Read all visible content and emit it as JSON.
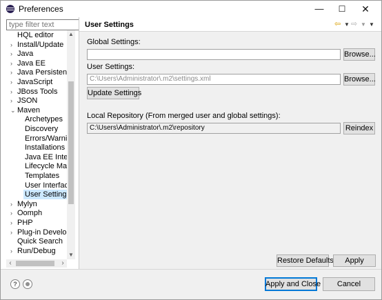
{
  "window": {
    "title": "Preferences"
  },
  "window_controls": {
    "minimize": "—",
    "maximize": "☐",
    "close": "✕"
  },
  "filter": {
    "placeholder": "type filter text"
  },
  "tree": {
    "items": [
      {
        "label": "HQL editor",
        "arrow": ""
      },
      {
        "label": "Install/Update",
        "arrow": "›"
      },
      {
        "label": "Java",
        "arrow": "›"
      },
      {
        "label": "Java EE",
        "arrow": "›"
      },
      {
        "label": "Java Persistence",
        "arrow": "›"
      },
      {
        "label": "JavaScript",
        "arrow": "›"
      },
      {
        "label": "JBoss Tools",
        "arrow": "›"
      },
      {
        "label": "JSON",
        "arrow": "›"
      },
      {
        "label": "Maven",
        "arrow": "⌄"
      },
      {
        "label": "Archetypes",
        "arrow": ""
      },
      {
        "label": "Discovery",
        "arrow": ""
      },
      {
        "label": "Errors/Warnings",
        "arrow": ""
      },
      {
        "label": "Installations",
        "arrow": ""
      },
      {
        "label": "Java EE Integration",
        "arrow": ""
      },
      {
        "label": "Lifecycle Mappings",
        "arrow": ""
      },
      {
        "label": "Templates",
        "arrow": ""
      },
      {
        "label": "User Interface",
        "arrow": ""
      },
      {
        "label": "User Settings",
        "arrow": ""
      },
      {
        "label": "Mylyn",
        "arrow": "›"
      },
      {
        "label": "Oomph",
        "arrow": "›"
      },
      {
        "label": "PHP",
        "arrow": "›"
      },
      {
        "label": "Plug-in Development",
        "arrow": "›"
      },
      {
        "label": "Quick Search",
        "arrow": ""
      },
      {
        "label": "Run/Debug",
        "arrow": "›"
      }
    ],
    "selected": "User Settings"
  },
  "scroll": {
    "up": "▲",
    "down": "▼",
    "left": "‹",
    "right": "›"
  },
  "page": {
    "title": "User Settings",
    "nav": {
      "back": "⇦",
      "back_dropdown": "▼",
      "forward": "⇨",
      "forward_dropdown": "▼",
      "menu": "▼"
    },
    "global_label": "Global Settings:",
    "global_value": "",
    "browse_label": "Browse...",
    "user_label": "User Settings:",
    "user_value": "C:\\Users\\Administrator\\.m2\\settings.xml",
    "update_label": "Update Settings",
    "local_repo_label": "Local Repository (From merged user and global settings):",
    "local_repo_value": "C:\\Users\\Administrator\\.m2\\repository",
    "reindex_label": "Reindex",
    "restore_defaults_label": "Restore Defaults",
    "apply_label": "Apply"
  },
  "footer": {
    "help_icon_glyph": "?",
    "apply_close_label": "Apply and Close",
    "cancel_label": "Cancel"
  }
}
